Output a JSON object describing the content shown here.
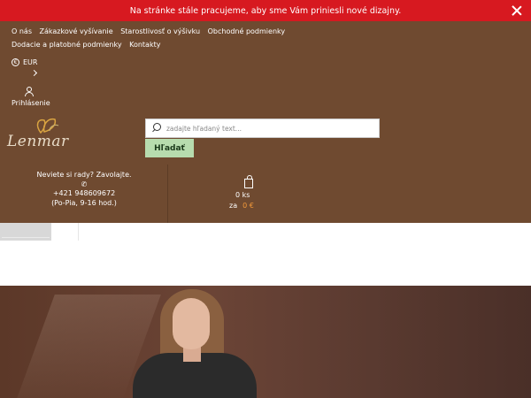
{
  "notice": {
    "text": "Na stránke stále pracujeme, aby sme Vám priniesli nové dizajny."
  },
  "nav": {
    "items": [
      {
        "label": "O nás"
      },
      {
        "label": "Zákazkové vyšívanie"
      },
      {
        "label": "Starostlivosť o výšivku"
      },
      {
        "label": "Obchodné podmienky"
      },
      {
        "label": "Dodacie a platobné podmienky"
      },
      {
        "label": "Kontakty"
      }
    ]
  },
  "currency": {
    "label": "EUR",
    "icon": "coin-icon"
  },
  "login": {
    "label": "Prihlásenie",
    "icon": "user-icon"
  },
  "logo": {
    "text": "Lenmar"
  },
  "search": {
    "placeholder": "zadajte hľadaný text...",
    "button_label": "Hľadať",
    "icon": "search-icon"
  },
  "contact": {
    "question": "Neviete si rady? Zavolajte.",
    "phone": "+421 948609672",
    "hours": "(Po-Pia, 9-16 hod.)",
    "icon": "phone-icon"
  },
  "cart": {
    "count": "0 ks",
    "total_prefix": "za",
    "total": "0 €",
    "icon": "bag-icon"
  },
  "colors": {
    "notice_bg": "#d71920",
    "header_bg": "#6f4a30",
    "search_button": "#b7dcae",
    "price": "#f49a3a"
  }
}
